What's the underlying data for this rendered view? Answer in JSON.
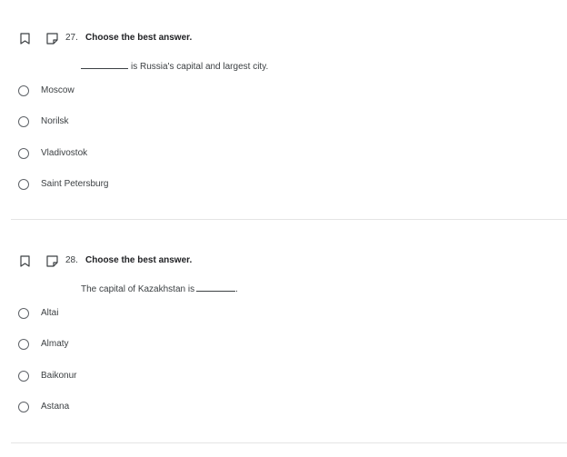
{
  "questions": [
    {
      "number": "27.",
      "instruction": "Choose the best answer.",
      "prompt_before": "",
      "prompt_after": "is Russia's capital and largest city.",
      "options": [
        "Moscow",
        "Norilsk",
        "Vladivostok",
        "Saint Petersburg"
      ]
    },
    {
      "number": "28.",
      "instruction": "Choose the best answer.",
      "prompt_before": "The capital of Kazakhstan is",
      "prompt_after": ".",
      "options": [
        "Altai",
        "Almaty",
        "Baikonur",
        "Astana"
      ]
    }
  ],
  "icons": {
    "bookmark": "bookmark-icon",
    "note": "note-icon"
  },
  "colors": {
    "text": "#202124",
    "muted": "#3c4043",
    "radio_border": "#5f6368",
    "divider": "#e4e4e4"
  }
}
